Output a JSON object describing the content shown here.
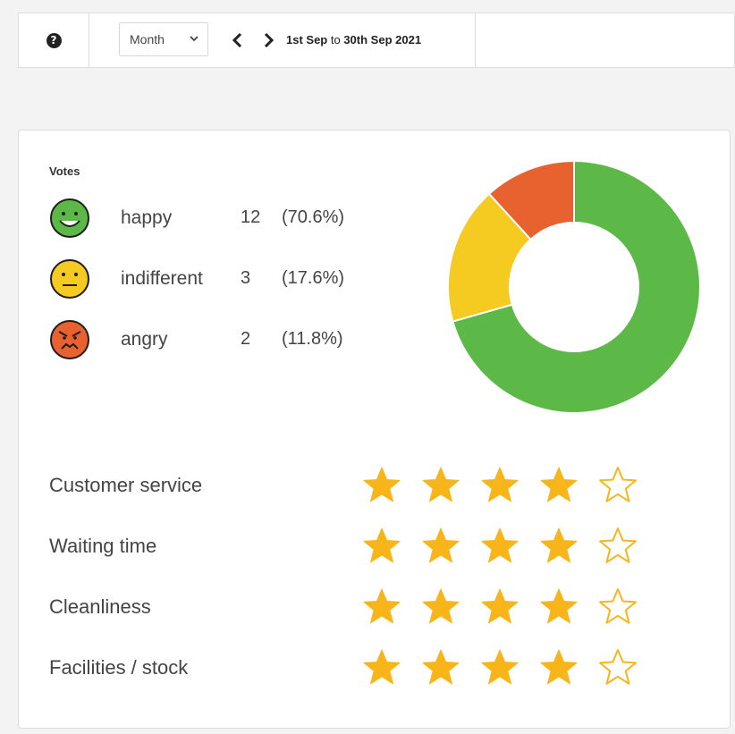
{
  "toolbar": {
    "help_icon": "question-circle-icon",
    "period": "Month",
    "date_start": "1st Sep",
    "date_sep": " to ",
    "date_end": "30th Sep 2021"
  },
  "votes": {
    "title": "Votes",
    "items": [
      {
        "label": "happy",
        "count": "12",
        "pct": "(70.6%)",
        "value": 12,
        "color": "#5cb947",
        "icon": "happy-face-icon"
      },
      {
        "label": "indifferent",
        "count": "3",
        "pct": "(17.6%)",
        "value": 3,
        "color": "#f5cb21",
        "icon": "indifferent-face-icon"
      },
      {
        "label": "angry",
        "count": "2",
        "pct": "(11.8%)",
        "value": 2,
        "color": "#e8622f",
        "icon": "angry-face-icon"
      }
    ]
  },
  "ratings": [
    {
      "label": "Customer service",
      "stars": 4,
      "max": 5
    },
    {
      "label": "Waiting time",
      "stars": 4,
      "max": 5
    },
    {
      "label": "Cleanliness",
      "stars": 4,
      "max": 5
    },
    {
      "label": "Facilities / stock",
      "stars": 4,
      "max": 5
    }
  ],
  "colors": {
    "star": "#f7b519",
    "border": "#dcdcdc"
  }
}
